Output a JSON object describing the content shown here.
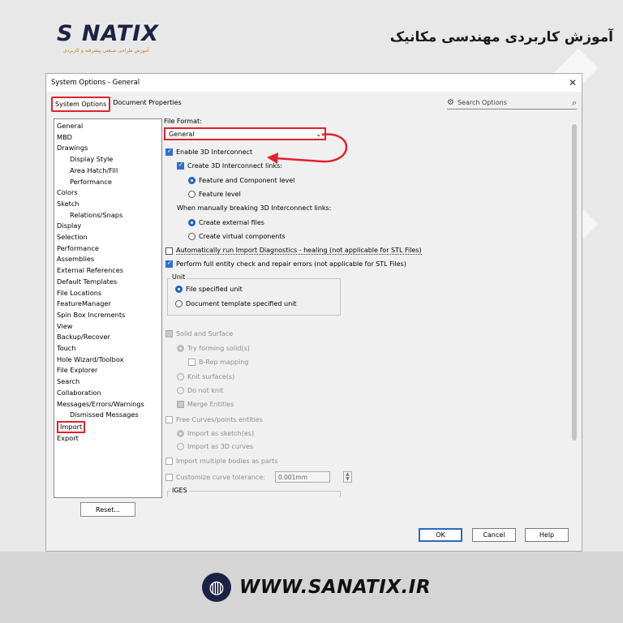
{
  "brand": {
    "logo_text": "S  NATIX",
    "logo_tagline": "آموزش طراحی صنعتی پیشرفته و کاربردی",
    "header_title": "آموزش کاربردی مهندسی مکانیک",
    "accent": "#e0222f",
    "navy": "#1c2244"
  },
  "window": {
    "title": "System Options - General",
    "close_icon": "close-icon"
  },
  "tabs": [
    {
      "label": "System Options"
    },
    {
      "label": "Document Properties"
    }
  ],
  "search": {
    "placeholder": "Search Options"
  },
  "tree": {
    "items": [
      "General",
      "MBD",
      "Drawings",
      "Display Style",
      "Area Hatch/Fill",
      "Performance",
      "Colors",
      "Sketch",
      "Relations/Snaps",
      "Display",
      "Selection",
      "Performance",
      "Assemblies",
      "External References",
      "Default Templates",
      "File Locations",
      "FeatureManager",
      "Spin Box Increments",
      "View",
      "Backup/Recover",
      "Touch",
      "Hole Wizard/Toolbox",
      "File Explorer",
      "Search",
      "Collaboration",
      "Messages/Errors/Warnings",
      "Dismissed Messages",
      "Import",
      "Export"
    ],
    "reset": "Reset..."
  },
  "content": {
    "file_format_label": "File Format:",
    "file_format_value": "General",
    "enable_3d": "Enable 3D Interconnect",
    "create_links": "Create 3D Interconnect links:",
    "feature_component": "Feature and Component level",
    "feature_level": "Feature level",
    "when_breaking": "When manually breaking 3D Interconnect links:",
    "create_external": "Create external files",
    "create_virtual": "Create virtual components",
    "auto_diagnostics": "Automatically run Import Diagnostics - healing (not applicable for STL Files)",
    "full_entity": "Perform full entity check and repair errors (not applicable for STL Files)",
    "unit_title": "Unit",
    "file_unit": "File specified unit",
    "doc_unit": "Document template specified unit",
    "solid_surface": "Solid and Surface",
    "try_solid": "Try forming solid(s)",
    "brep": "B-Rep mapping",
    "knit": "Knit surface(s)",
    "no_knit": "Do not knit",
    "merge": "Merge Entities",
    "free_curves": "Free Curves/points entities",
    "import_sketch": "Import as sketch(es)",
    "import_3d": "Import as 3D curves",
    "multi_bodies": "Import multiple bodies as parts",
    "curve_tol": "Customize curve tolerance:",
    "curve_tol_value": "0.001mm",
    "iges": "IGES"
  },
  "buttons": {
    "ok": "OK",
    "cancel": "Cancel",
    "help": "Help"
  },
  "footer": {
    "url": "WWW.SANATIX.IR"
  }
}
